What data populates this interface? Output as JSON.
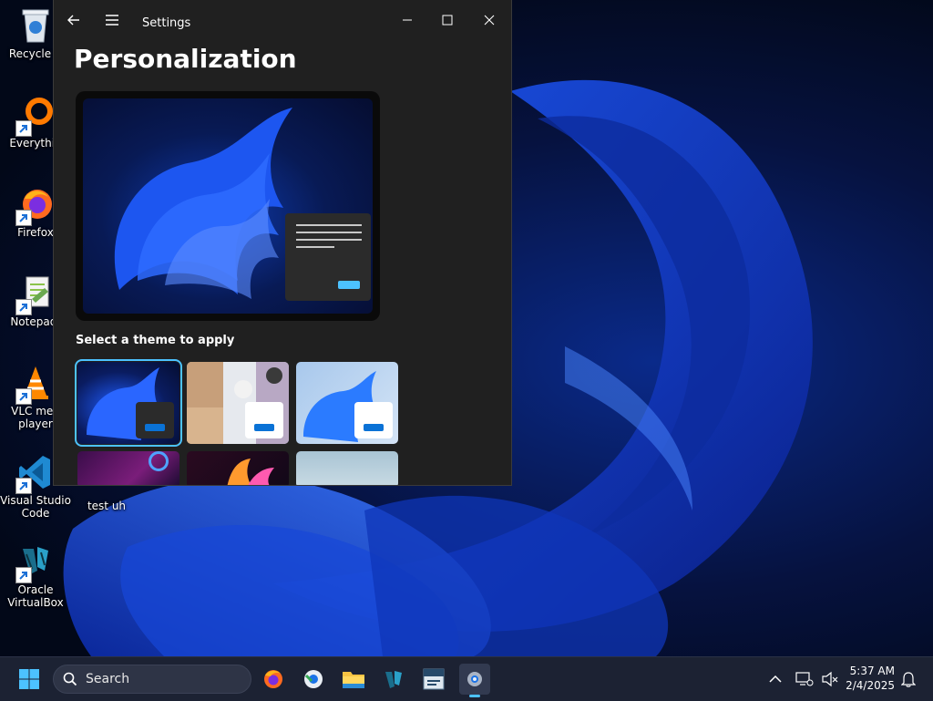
{
  "desktop": {
    "icons": [
      {
        "label": "Recycle B"
      },
      {
        "label": "Everythin"
      },
      {
        "label": "Firefox"
      },
      {
        "label": "Notepad-"
      },
      {
        "label": "VLC med player"
      },
      {
        "label": "Visual Studio Code"
      },
      {
        "label": "Oracle VirtualBox"
      },
      {
        "label": "test uh"
      }
    ]
  },
  "settings": {
    "title": "Settings",
    "page_title": "Personalization",
    "section_label": "Select a theme to apply"
  },
  "taskbar": {
    "search_label": "Search",
    "time": "5:37 AM",
    "date": "2/4/2025"
  },
  "colors": {
    "accent": "#4cc2ff",
    "window_bg": "#202020",
    "taskbar_bg": "#1c2233"
  }
}
